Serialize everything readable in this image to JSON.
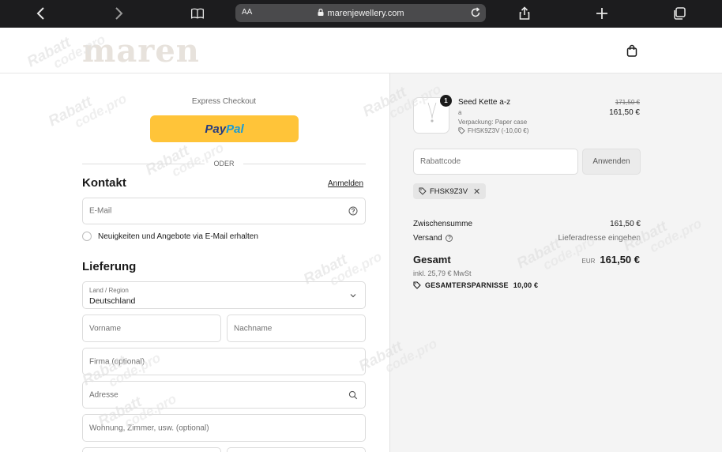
{
  "browser": {
    "text_size_label": "AA",
    "url": "marenjewellery.com"
  },
  "header": {
    "logo": "maren"
  },
  "checkout": {
    "express_title": "Express Checkout",
    "paypal_label_1": "Pay",
    "paypal_label_2": "Pal",
    "divider_text": "ODER",
    "contact": {
      "title": "Kontakt",
      "login_link": "Anmelden",
      "email_placeholder": "E-Mail",
      "newsletter_label": "Neuigkeiten und Angebote via E-Mail erhalten"
    },
    "delivery": {
      "title": "Lieferung",
      "country_label": "Land / Region",
      "country_value": "Deutschland",
      "first_name_placeholder": "Vorname",
      "last_name_placeholder": "Nachname",
      "company_placeholder": "Firma (optional)",
      "address_placeholder": "Adresse",
      "apartment_placeholder": "Wohnung, Zimmer, usw. (optional)"
    }
  },
  "summary": {
    "product": {
      "quantity": "1",
      "name": "Seed Kette a-z",
      "variant": "a",
      "packaging": "Verpackung: Paper case",
      "discount_code": "FHSK9Z3V (-10,00 €)",
      "price_old": "171,50 €",
      "price_new": "161,50 €"
    },
    "discount_placeholder": "Rabattcode",
    "apply_label": "Anwenden",
    "applied_code": "FHSK9Z3V",
    "subtotal_label": "Zwischensumme",
    "subtotal_value": "161,50 €",
    "shipping_label": "Versand",
    "shipping_value": "Lieferadresse eingeben",
    "total_label": "Gesamt",
    "total_currency": "EUR",
    "total_value": "161,50 €",
    "tax_line": "inkl. 25,79 € MwSt",
    "savings_label": "GESAMTERSPARNISSE",
    "savings_value": "10,00 €"
  },
  "watermark": {
    "line1": "Rabatt",
    "line2": "code.pro"
  },
  "colors": {
    "paypal_yellow": "#ffc439",
    "paypal_dark_blue": "#253b80",
    "paypal_light_blue": "#179bd7",
    "browser_bar": "#1c1c1e",
    "summary_bg": "#f4f4f4"
  }
}
